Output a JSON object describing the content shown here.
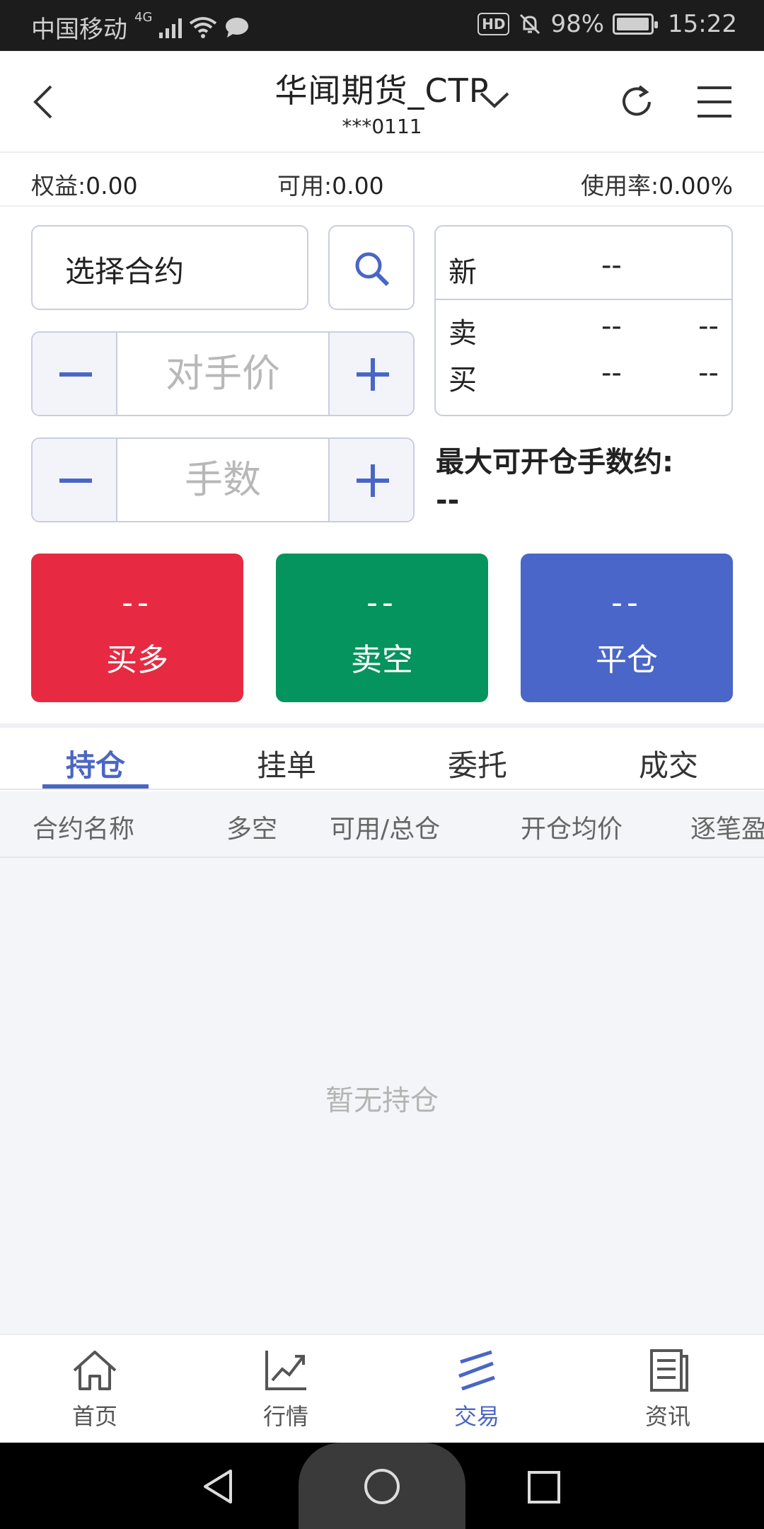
{
  "status_bar": {
    "carrier": "中国移动",
    "network": "4G",
    "hd_label": "HD",
    "battery_text": "98%",
    "battery_level": 0.98,
    "time": "15:22"
  },
  "header": {
    "title": "华闻期货_CTP",
    "account_masked": "***0111"
  },
  "account": {
    "equity_label": "权益:",
    "equity_value": "0.00",
    "available_label": "可用:",
    "available_value": "0.00",
    "usage_label": "使用率:",
    "usage_value": "0.00%"
  },
  "order_form": {
    "contract_placeholder": "选择合约",
    "price_placeholder": "对手价",
    "lots_placeholder": "手数",
    "max_open_label": "最大可开仓手数约:",
    "max_open_value": "--"
  },
  "quote": {
    "latest_label": "新",
    "latest_value": "--",
    "ask_label": "卖",
    "ask_price": "--",
    "ask_volume": "--",
    "bid_label": "买",
    "bid_price": "--",
    "bid_volume": "--"
  },
  "actions": {
    "buy_value": "--",
    "buy_label": "买多",
    "sell_value": "--",
    "sell_label": "卖空",
    "close_value": "--",
    "close_label": "平仓"
  },
  "tabs": [
    "持仓",
    "挂单",
    "委托",
    "成交"
  ],
  "active_tab": "持仓",
  "columns": [
    "合约名称",
    "多空",
    "可用/总仓",
    "开仓均价",
    "逐笔盈"
  ],
  "empty_text": "暂无持仓",
  "bottom_nav": {
    "home": "首页",
    "market": "行情",
    "trade": "交易",
    "news": "资讯",
    "active": "交易"
  },
  "colors": {
    "accent": "#4a66c4",
    "buy": "#e72a42",
    "sell": "#05935e",
    "close": "#4a66c8"
  }
}
